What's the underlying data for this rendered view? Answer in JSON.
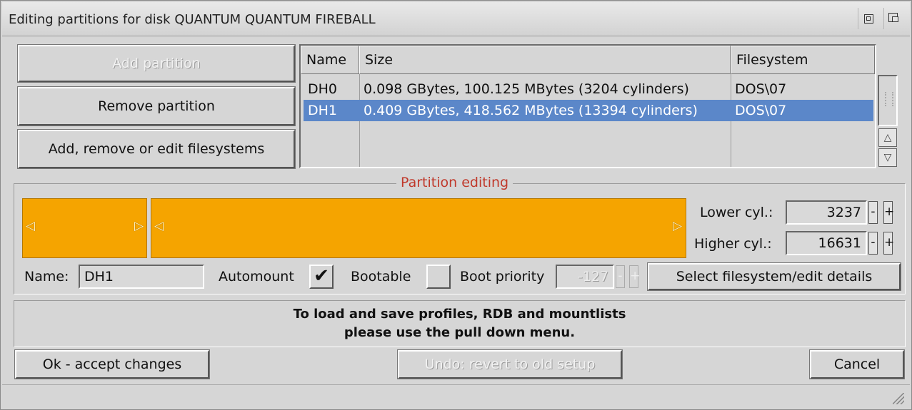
{
  "window": {
    "title": "Editing partitions for disk QUANTUM QUANTUM FIREBALL"
  },
  "actions": {
    "add_partition": "Add partition",
    "remove_partition": "Remove partition",
    "edit_filesystems": "Add, remove or edit filesystems"
  },
  "table": {
    "headers": [
      "Name",
      "Size",
      "Filesystem"
    ],
    "rows": [
      {
        "name": "DH0",
        "size": "0.098 GBytes, 100.125 MBytes (3204 cylinders)",
        "fs": "DOS\\07"
      },
      {
        "name": "DH1",
        "size": "0.409 GBytes, 418.562 MBytes (13394 cylinders)",
        "fs": "DOS\\07"
      }
    ],
    "selected_row": 1
  },
  "partition_editing": {
    "title": "Partition editing",
    "lower_cyl_label": "Lower cyl.:",
    "lower_cyl_value": "3237",
    "higher_cyl_label": "Higher cyl.:",
    "higher_cyl_value": "16631",
    "minus": "-",
    "plus": "+",
    "name_label": "Name:",
    "name_value": "DH1",
    "automount_label": "Automount",
    "automount_checked": true,
    "bootable_label": "Bootable",
    "bootable_checked": false,
    "boot_priority_label": "Boot priority",
    "boot_priority_value": "-127",
    "select_fs_button": "Select filesystem/edit details",
    "check_mark": "✔"
  },
  "info": {
    "line1": "To load and save profiles, RDB and mountlists",
    "line2": "please use the pull down menu."
  },
  "footer": {
    "ok": "Ok - accept changes",
    "undo": "Undo: revert to old setup",
    "cancel": "Cancel"
  },
  "icons": {
    "titlebar": [
      "iconify-icon",
      "depth-icon"
    ],
    "scroll": [
      "scroll-up-icon",
      "scroll-down-icon"
    ],
    "resize": "resize-grip-icon"
  },
  "colors": {
    "selection": "#5b87c9",
    "partition_bar": "#f5a400",
    "group_title": "#c0392b"
  }
}
